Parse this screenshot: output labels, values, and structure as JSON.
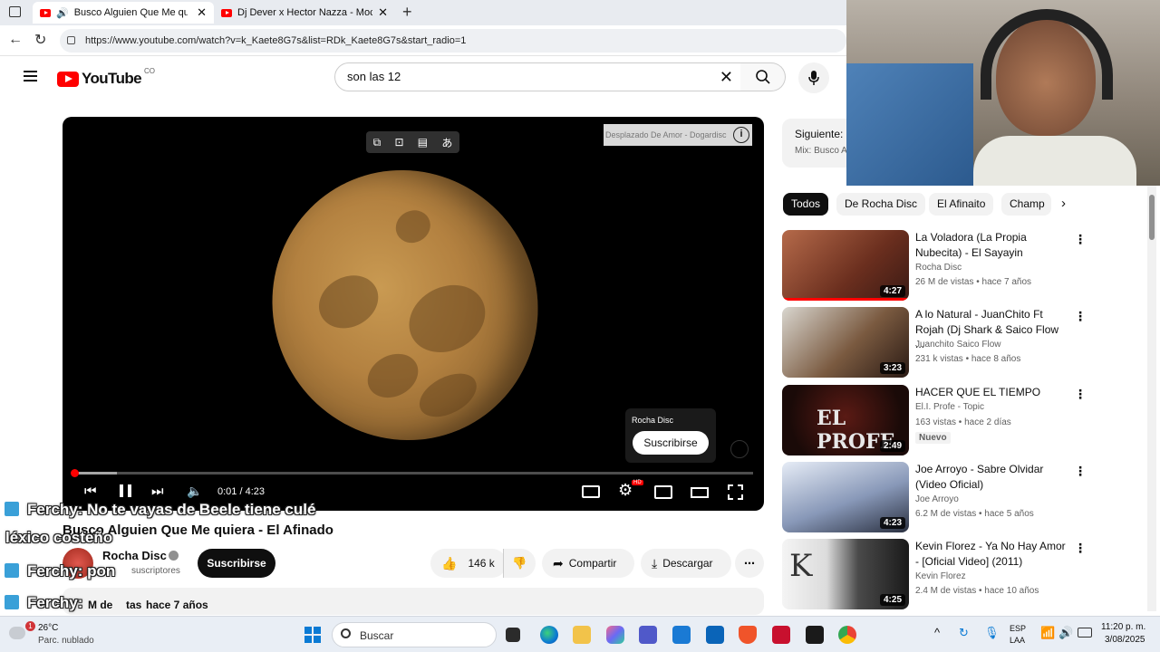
{
  "browser": {
    "tabs": [
      {
        "title": "Busco Alguien Que Me quiera"
      },
      {
        "title": "Dj Dever x Hector Nazza - Mocca"
      }
    ],
    "url": "https://www.youtube.com/watch?v=k_Kaete8G7s&list=RDk_Kaete8G7s&start_radio=1"
  },
  "youtube": {
    "logo_text": "YouTube",
    "country": "CO",
    "search_value": "son las 12"
  },
  "player": {
    "info_card": "Desplazado De Amor - Dogardisc",
    "branding_channel": "Rocha Disc",
    "branding_subscribe": "Suscribirse",
    "time": "0:01 / 4:23",
    "progress": 0.004,
    "quality_badge": "HD"
  },
  "video": {
    "title": "Busco Alguien Que Me quiera - El Afinado",
    "channel": "Rocha Disc",
    "subscribers": "suscriptores",
    "subscribe_label": "Suscribirse",
    "likes": "146 k",
    "share_label": "Compartir",
    "download_label": "Descargar",
    "views_partial": "M de",
    "views_partial2": "tas",
    "age": "hace 7 años"
  },
  "sidebar": {
    "next_label": "Siguiente:",
    "next_sub": "Mix: Busco A",
    "chips": [
      "Todos",
      "De Rocha Disc",
      "El Afinaito",
      "Champ"
    ],
    "videos": [
      {
        "title": "La Voladora (La Propia Nubecita) - El Sayayin",
        "channel": "Rocha Disc",
        "stats": "26 M de vistas • hace 7 años",
        "duration": "4:27",
        "badge": ""
      },
      {
        "title": "A lo Natural - JuanChito Ft Rojah (Dj Shark & Saico Flow ...",
        "channel": "Juanchito Saico Flow",
        "stats": "231 k vistas • hace 8 años",
        "duration": "3:23",
        "badge": ""
      },
      {
        "title": "HACER QUE EL TIEMPO",
        "channel": "El.I. Profe - Topic",
        "stats": "163 vistas • hace 2 días",
        "duration": "2:49",
        "badge": "Nuevo"
      },
      {
        "title": "Joe Arroyo - Sabre Olvidar (Video Oficial)",
        "channel": "Joe Arroyo",
        "stats": "6.2 M de vistas • hace 5 años",
        "duration": "4:23",
        "badge": ""
      },
      {
        "title": "Kevin Florez - Ya No Hay Amor - [Oficial Video] (2011)",
        "channel": "Kevin Florez",
        "stats": "2.4 M de vistas • hace 10 años",
        "duration": "4:25",
        "badge": ""
      }
    ]
  },
  "overlay_chat": [
    {
      "user": "Ferchy",
      "message": ": No te vayas de Beele tiene culé"
    },
    {
      "user": "",
      "message": "léxico costeño"
    },
    {
      "user": "Ferchy",
      "message": ": pon"
    },
    {
      "user": "Ferchy",
      "message": ":"
    }
  ],
  "taskbar": {
    "weather_temp": "26°C",
    "weather_desc": "Parc. nublado",
    "weather_badge": "1",
    "search_placeholder": "Buscar",
    "lang_top": "ESP",
    "lang_bottom": "LAA",
    "time": "11:20 p. m.",
    "date": "3/08/2025"
  }
}
